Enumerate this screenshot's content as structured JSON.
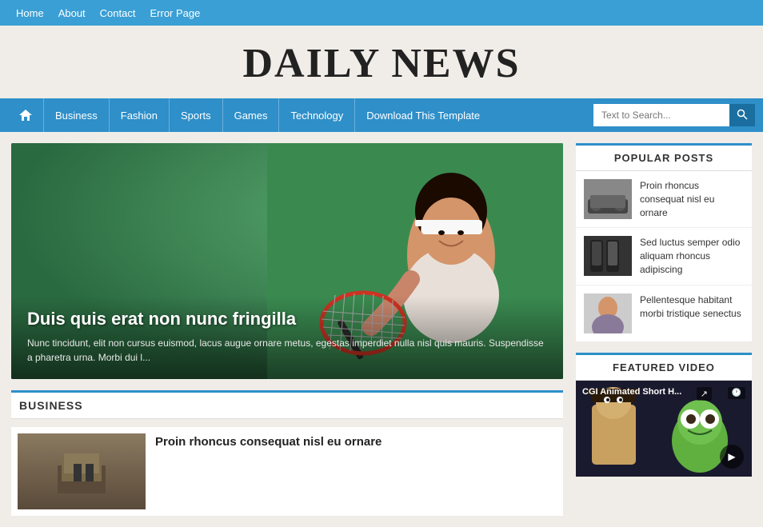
{
  "topnav": {
    "items": [
      "Home",
      "About",
      "Contact",
      "Error Page"
    ]
  },
  "header": {
    "title": "DAILY NEWS"
  },
  "mainnav": {
    "home_icon": "⌂",
    "items": [
      "Business",
      "Fashion",
      "Sports",
      "Games",
      "Technology"
    ],
    "download": "Download This Template",
    "search_placeholder": "Text to Search...",
    "search_icon": "🔍"
  },
  "hero": {
    "dots": [
      true,
      false,
      false,
      false,
      false
    ],
    "title": "Duis quis erat non nunc fringilla",
    "excerpt": "Nunc tincidunt, elit non cursus euismod, lacus augue ornare metus, egestas imperdiet nulla nisl quis mauris. Suspendisse a pharetra urna. Morbi dui l..."
  },
  "business": {
    "section_title": "BUSINESS",
    "post_title": "Proin rhoncus consequat nisl eu ornare"
  },
  "sidebar": {
    "popular_posts": {
      "title": "POPULAR POSTS",
      "items": [
        {
          "text": "Proin rhoncus consequat nisl eu ornare",
          "thumb_type": "car"
        },
        {
          "text": "Sed luctus semper odio aliquam rhoncus adipiscing",
          "thumb_type": "phone"
        },
        {
          "text": "Pellentesque habitant morbi tristique senectus",
          "thumb_type": "person"
        }
      ]
    },
    "featured_video": {
      "title": "FEATURED VIDEO",
      "video_title": "CGI Animated Short H...",
      "play_icon": "▶",
      "time_icon": "🕐",
      "share_icon": "↗"
    }
  }
}
